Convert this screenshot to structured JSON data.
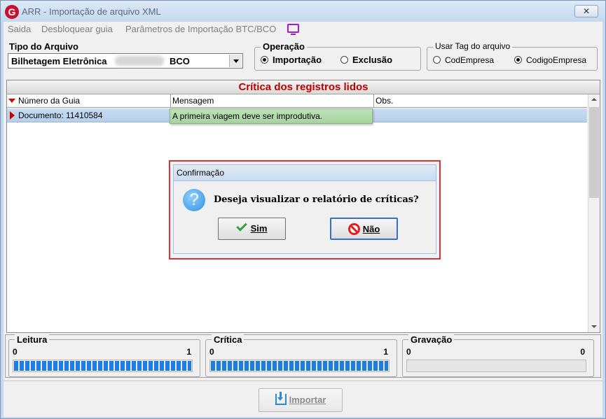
{
  "window": {
    "title": "ARR - Importação de arquivo XML",
    "close_label": "✕"
  },
  "menu": {
    "items": [
      "Saida",
      "Desbloquear guia",
      "Parâmetros de Importação BTC/BCO"
    ]
  },
  "tipo_arquivo": {
    "label": "Tipo do Arquivo",
    "value": "Bilhetagem Eletrônica",
    "value_suffix": "BCO"
  },
  "operacao": {
    "title": "Operação",
    "options": [
      "Importação",
      "Exclusão"
    ],
    "selected": "Importação"
  },
  "usar_tag": {
    "title": "Usar Tag do arquivo",
    "options": [
      "CodEmpresa",
      "CodigoEmpresa"
    ],
    "selected": "CodigoEmpresa"
  },
  "grid": {
    "title": "Crítica dos registros lidos",
    "columns": [
      "Número da Guia",
      "Mensagem",
      "Obs."
    ],
    "rows": [
      {
        "guia": "Documento: 11410584",
        "mensagem": "A primeira viagem deve ser improdutiva.",
        "obs": ""
      }
    ]
  },
  "dialog": {
    "title": "Confirmação",
    "message": "Deseja visualizar o relatório de críticas?",
    "yes_label": "Sim",
    "no_label": "Não"
  },
  "progress": {
    "leitura": {
      "label": "Leitura",
      "min": "0",
      "max": "1",
      "fraction": 1
    },
    "critica": {
      "label": "Crítica",
      "min": "0",
      "max": "1",
      "fraction": 1
    },
    "gravacao": {
      "label": "Gravação",
      "min": "0",
      "max": "0",
      "fraction": 0
    }
  },
  "footer": {
    "import_label": "Importar"
  },
  "colors": {
    "accent": "#1c7fe0",
    "grid_title": "#c00000",
    "dialog_border": "#e03030"
  }
}
